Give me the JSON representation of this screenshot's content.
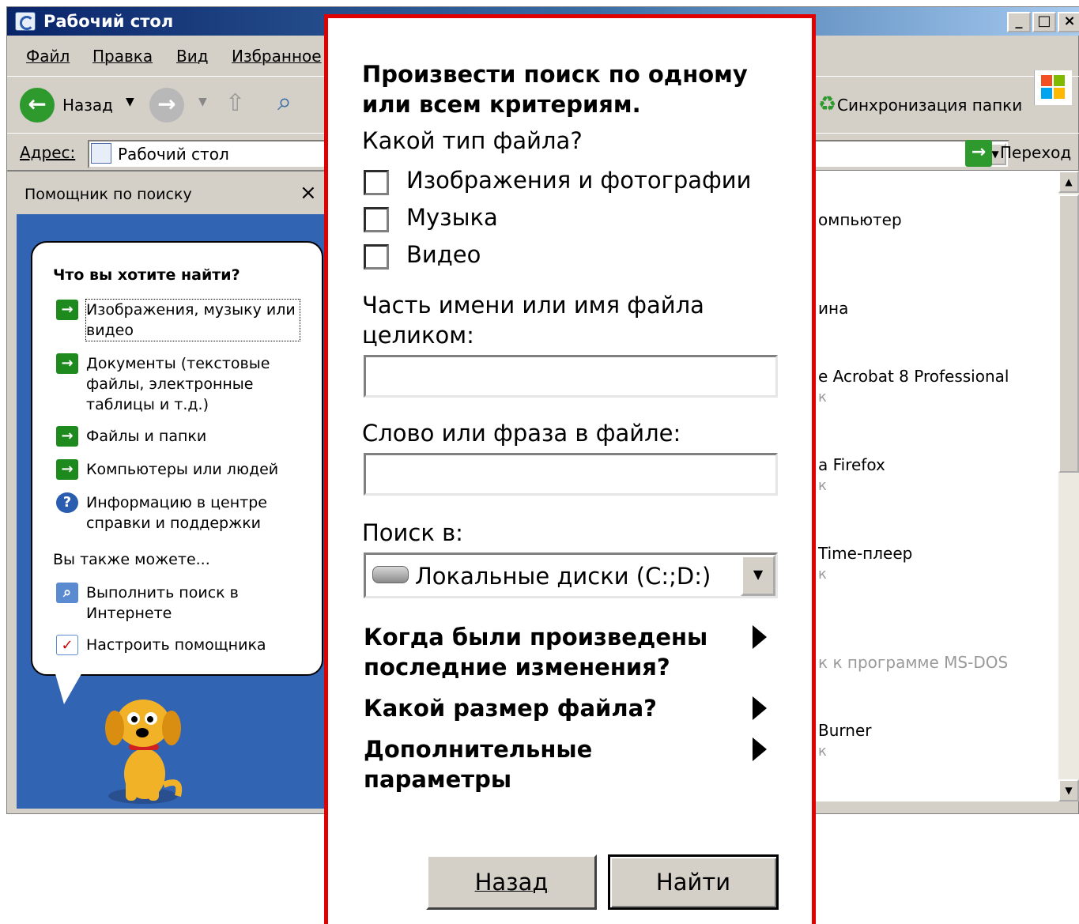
{
  "window": {
    "title": "Рабочий стол",
    "minimize_label": "_",
    "maximize_label": "□",
    "close_label": "×"
  },
  "menu": [
    "Файл",
    "Правка",
    "Вид",
    "Избранное"
  ],
  "toolbar": {
    "back_label": "Назад",
    "sync_label": "Синхронизация папки"
  },
  "address": {
    "label": "Адрес:",
    "value": "Рабочий стол",
    "go_label": "Переход"
  },
  "assistant": {
    "pane_title": "Помощник по поиску",
    "close_label": "×",
    "question": "Что вы хотите найти?",
    "options": [
      {
        "label": "Изображения, музыку или видео",
        "icon": "arrow-right-icon"
      },
      {
        "label": "Документы (текстовые файлы, электронные таблицы и т.д.)",
        "icon": "arrow-right-icon"
      },
      {
        "label": "Файлы и папки",
        "icon": "arrow-right-icon"
      },
      {
        "label": "Компьютеры или людей",
        "icon": "arrow-right-icon"
      },
      {
        "label": "Информацию в центре справки и поддержки",
        "icon": "help-icon"
      }
    ],
    "also_label": "Вы также можете...",
    "extra_options": [
      {
        "label": "Выполнить поиск в Интернете",
        "icon": "web-search-icon"
      },
      {
        "label": "Настроить помощника",
        "icon": "checklist-icon"
      }
    ]
  },
  "list_items": [
    {
      "text": "омпьютер",
      "sub": ""
    },
    {
      "text": "ина",
      "sub": ""
    },
    {
      "text": "e Acrobat 8 Professional",
      "sub": "к"
    },
    {
      "text": "a Firefox",
      "sub": "к"
    },
    {
      "text": "Time-плеер",
      "sub": "к"
    },
    {
      "text": "к к программе MS-DOS",
      "sub": ""
    },
    {
      "text": "Burner",
      "sub": "к"
    }
  ],
  "dialog": {
    "heading": "Произвести поиск по одному или всем критериям.",
    "file_type_question": "Какой тип файла?",
    "file_types": [
      "Изображения и фотографии",
      "Музыка",
      "Видео"
    ],
    "name_label": "Часть имени или имя файла целиком:",
    "name_value": "",
    "phrase_label": "Слово или фраза в файле:",
    "phrase_value": "",
    "search_in_label": "Поиск в:",
    "search_in_value": "Локальные диски (C:;D:)",
    "expanders": [
      "Когда были произведены последние изменения?",
      "Какой размер файла?",
      "Дополнительные параметры"
    ],
    "back_button": "Назад",
    "find_button": "Найти"
  },
  "colors": {
    "title_gradient_start": "#0a246a",
    "pane_blue": "#3264b4",
    "highlight_border": "#e00000",
    "arrow_green": "#1e8a1e"
  }
}
